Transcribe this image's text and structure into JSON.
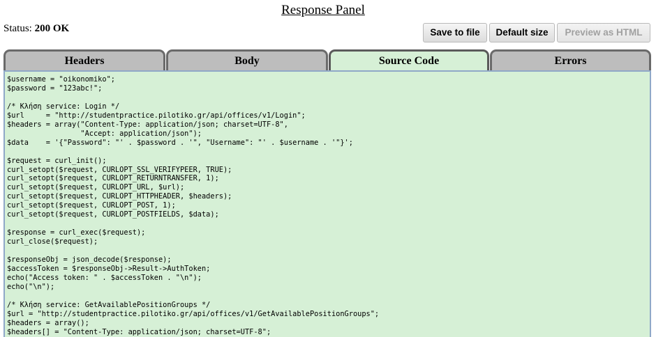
{
  "header": {
    "title": "Response Panel",
    "status_label": "Status:",
    "status_value": "200 OK"
  },
  "toolbar": {
    "save_to_file": "Save to file",
    "default_size": "Default size",
    "preview_as_html": "Preview as HTML"
  },
  "tabs": [
    {
      "label": "Headers",
      "active": false
    },
    {
      "label": "Body",
      "active": false
    },
    {
      "label": "Source Code",
      "active": true
    },
    {
      "label": "Errors",
      "active": false
    }
  ],
  "source_code": {
    "lines": [
      "$username = \"oikonomiko\";",
      "$password = \"123abc!\";",
      "",
      "/* Κλήση service: Login */",
      "$url     = \"http://studentpractice.pilotiko.gr/api/offices/v1/Login\";",
      "$headers = array(\"Content-Type: application/json; charset=UTF-8\",",
      "                 \"Accept: application/json\");",
      "$data    = '{\"Password\": \"' . $password . '\", \"Username\": \"' . $username . '\"}';",
      "",
      "$request = curl_init();",
      "curl_setopt($request, CURLOPT_SSL_VERIFYPEER, TRUE);",
      "curl_setopt($request, CURLOPT_RETURNTRANSFER, 1);",
      "curl_setopt($request, CURLOPT_URL, $url);",
      "curl_setopt($request, CURLOPT_HTTPHEADER, $headers);",
      "curl_setopt($request, CURLOPT_POST, 1);",
      "curl_setopt($request, CURLOPT_POSTFIELDS, $data);",
      "",
      "$response = curl_exec($request);",
      "curl_close($request);",
      "",
      "$responseObj = json_decode($response);",
      "$accessToken = $responseObj->Result->AuthToken;",
      "echo(\"Access token: \" . $accessToken . \"\\n\");",
      "echo(\"\\n\");",
      "",
      "/* Κλήση service: GetAvailablePositionGroups */",
      "$url = \"http://studentpractice.pilotiko.gr/api/offices/v1/GetAvailablePositionGroups\";",
      "$headers = array();",
      "$headers[] = \"Content-Type: application/json; charset=UTF-8\";"
    ]
  }
}
